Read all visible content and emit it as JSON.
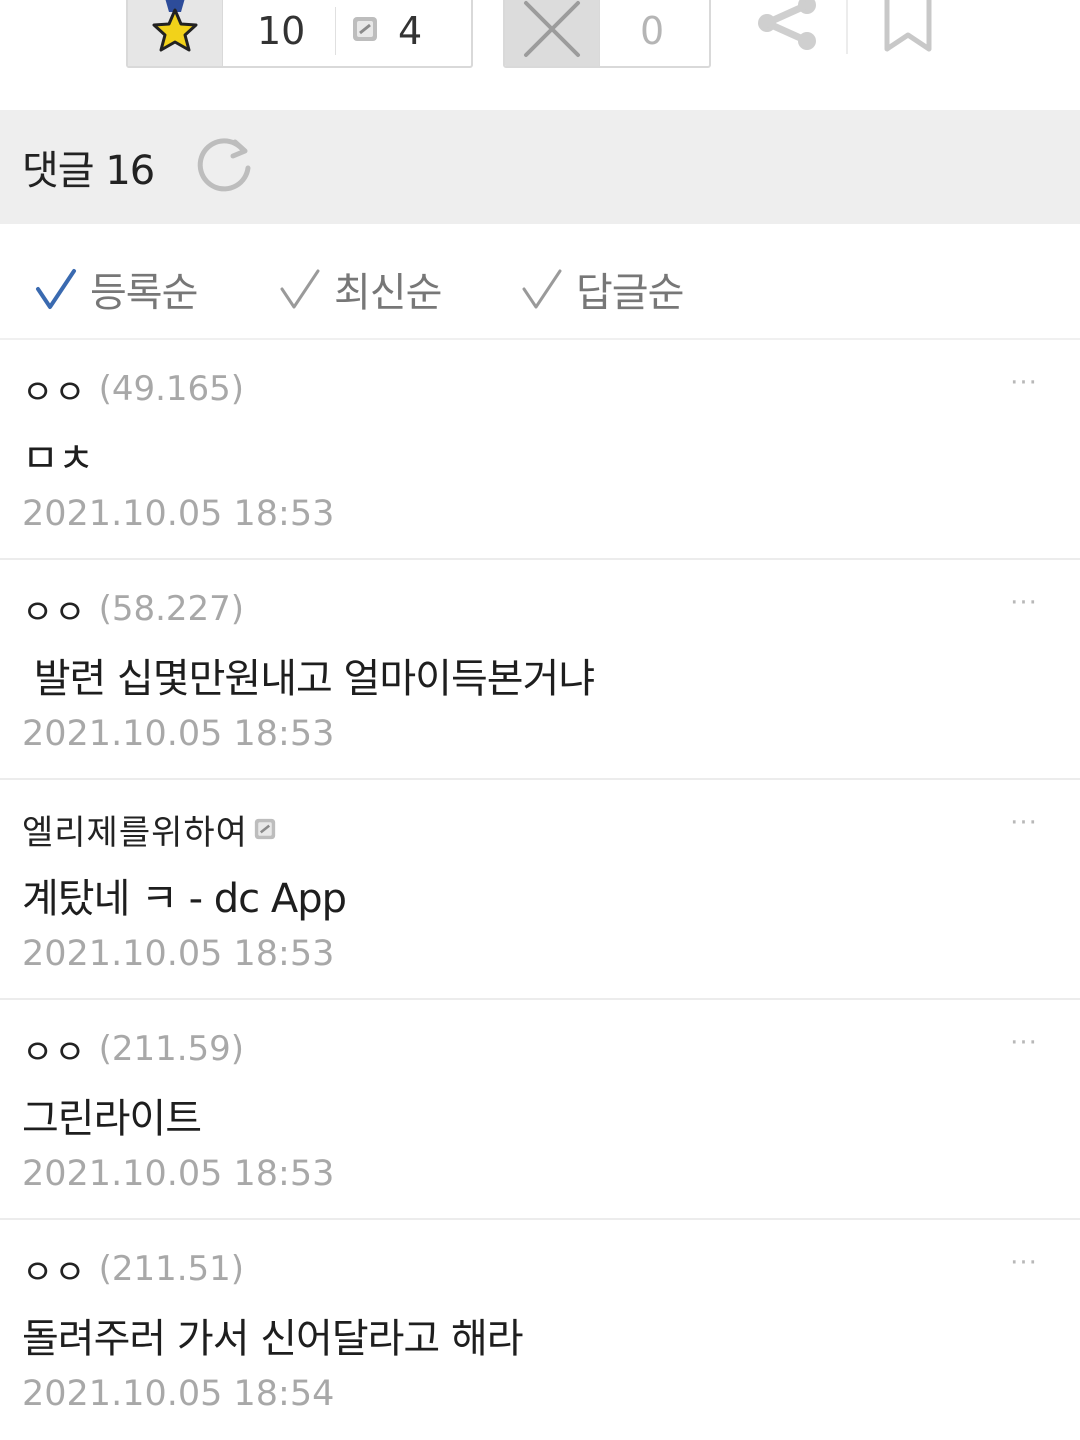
{
  "actions": {
    "upvote_count": "10",
    "fixed_upvote_count": "4",
    "downvote_count": "0"
  },
  "comments_header": {
    "label": "댓글 16"
  },
  "sort": {
    "options": [
      {
        "label": "등록순",
        "active": true
      },
      {
        "label": "최신순",
        "active": false
      },
      {
        "label": "답글순",
        "active": false
      }
    ]
  },
  "comments": [
    {
      "author": "ㅇㅇ",
      "ip": "(49.165)",
      "fixed": false,
      "body": "ㅁㅊ",
      "date": "2021.10.05 18:53"
    },
    {
      "author": "ㅇㅇ",
      "ip": "(58.227)",
      "fixed": false,
      "body": " 발련 십몇만원내고 얼마이득본거냐",
      "date": "2021.10.05 18:53"
    },
    {
      "author": "엘리제를위하여",
      "ip": "",
      "fixed": true,
      "body": "계탔네 ㅋ - dc App",
      "date": "2021.10.05 18:53"
    },
    {
      "author": "ㅇㅇ",
      "ip": "(211.59)",
      "fixed": false,
      "body": "그린라이트",
      "date": "2021.10.05 18:53"
    },
    {
      "author": "ㅇㅇ",
      "ip": "(211.51)",
      "fixed": false,
      "body": "돌려주러 가서 신어달라고 해라",
      "date": "2021.10.05 18:54"
    }
  ],
  "more_label": "···",
  "colors": {
    "accent_check": "#3a6ab0",
    "inactive_check": "#9a9a9a",
    "header_bg": "#eeeeee",
    "muted_text": "#a8a8a8"
  },
  "icons": {
    "upvote": "star-icon",
    "fixed_upvote": "fixed-user-icon",
    "downvote": "x-icon",
    "share": "share-icon",
    "bookmark": "bookmark-icon",
    "refresh": "refresh-icon",
    "check": "check-icon",
    "more": "more-icon"
  }
}
